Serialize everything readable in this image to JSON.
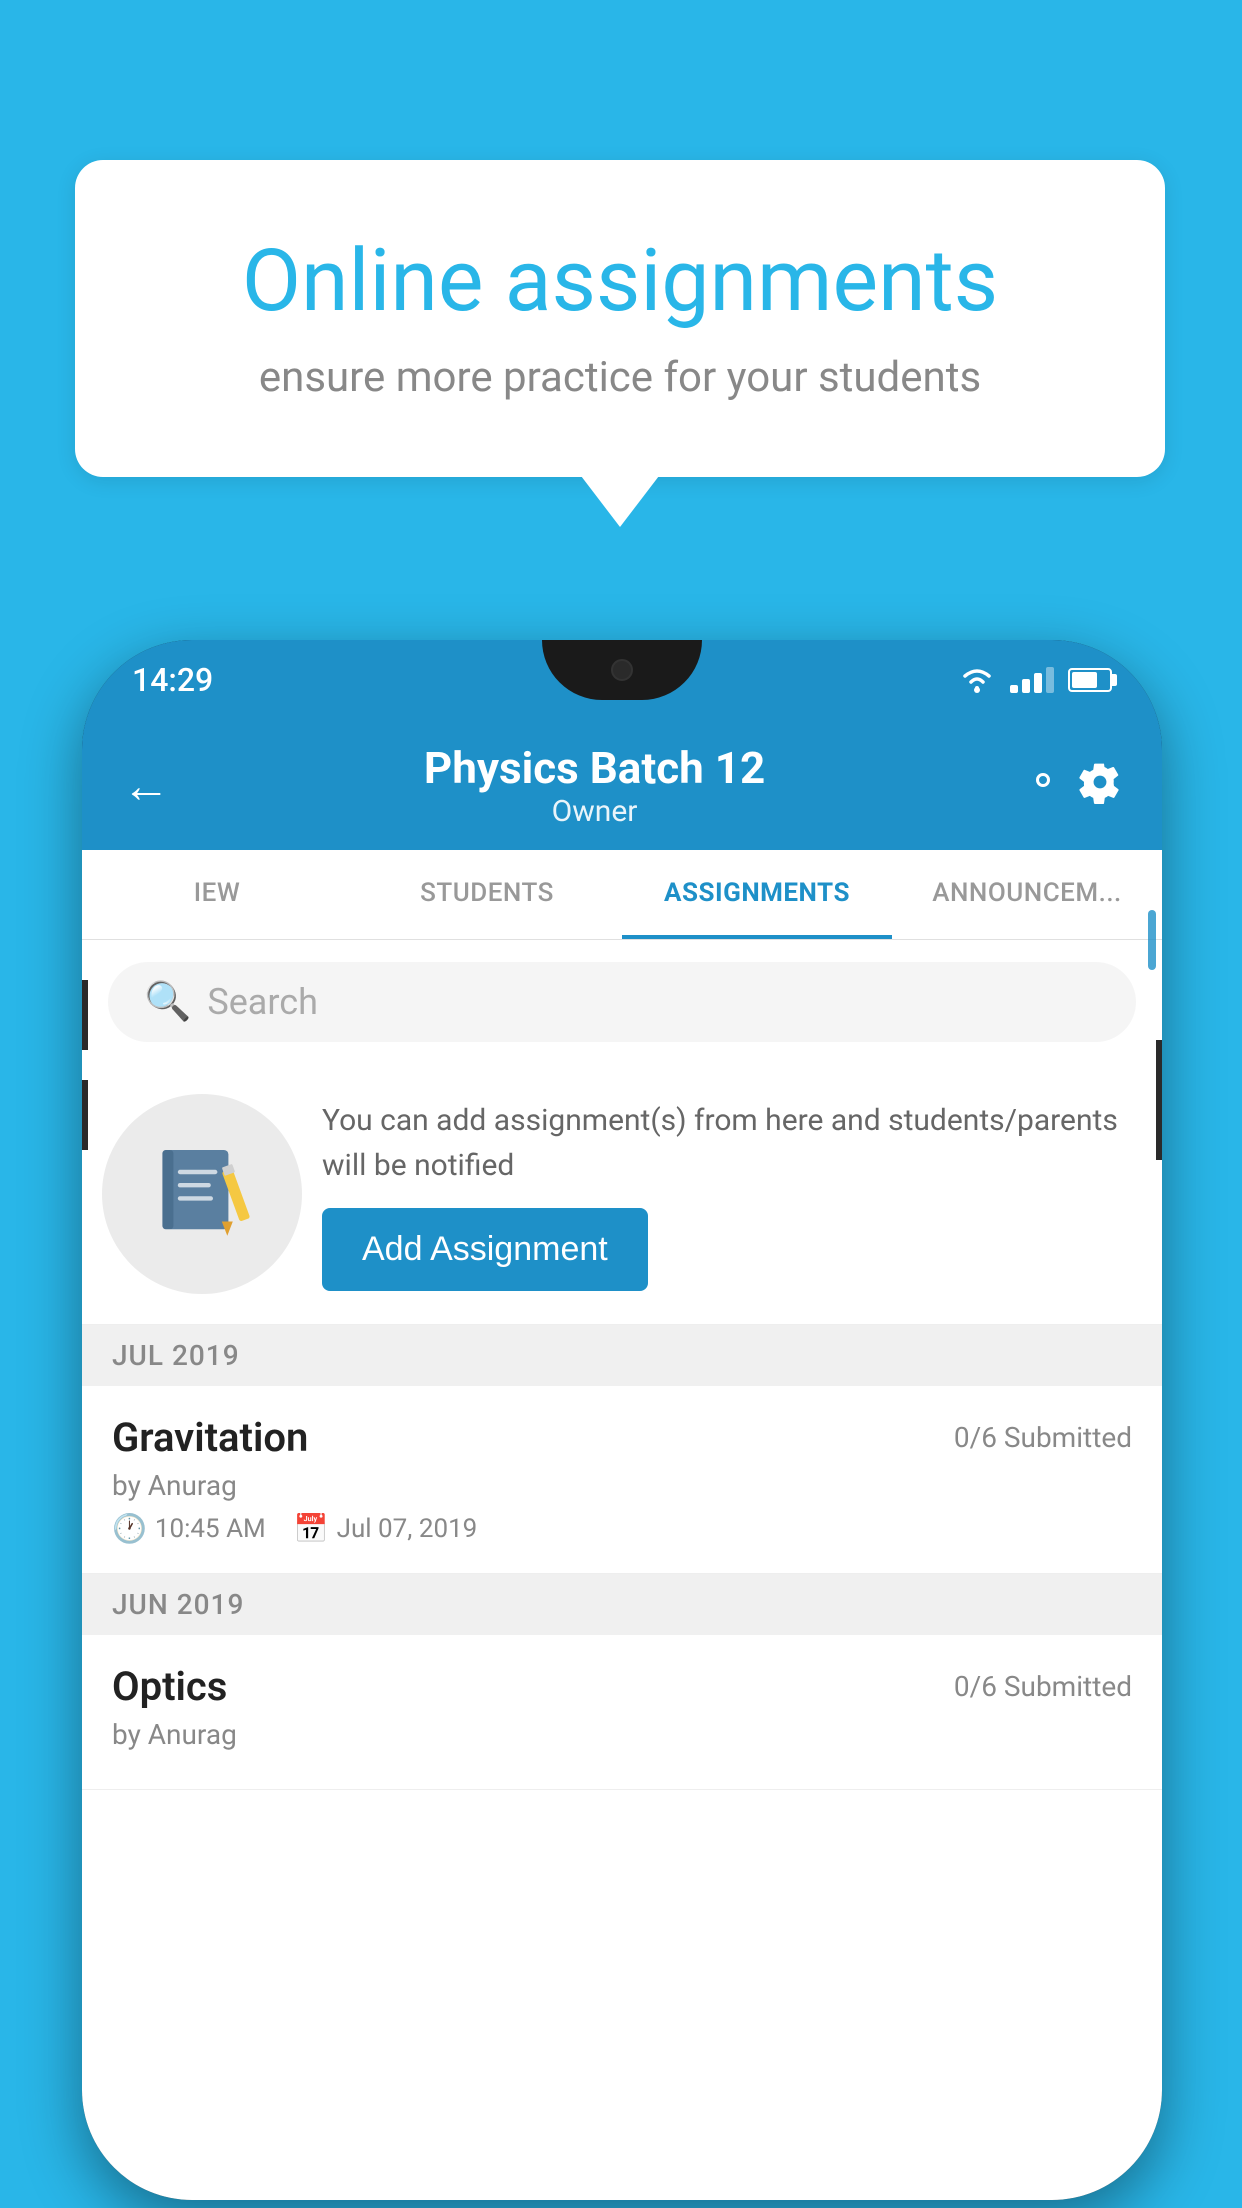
{
  "background": {
    "color": "#29b6e8"
  },
  "speech_bubble": {
    "title": "Online assignments",
    "subtitle": "ensure more practice for your students"
  },
  "phone": {
    "status_bar": {
      "time": "14:29"
    },
    "header": {
      "title": "Physics Batch 12",
      "subtitle": "Owner",
      "back_label": "←"
    },
    "tabs": [
      {
        "label": "IEW",
        "active": false
      },
      {
        "label": "STUDENTS",
        "active": false
      },
      {
        "label": "ASSIGNMENTS",
        "active": true
      },
      {
        "label": "ANNOUNCEM...",
        "active": false
      }
    ],
    "search": {
      "placeholder": "Search"
    },
    "promo": {
      "description": "You can add assignment(s) from here and students/parents will be notified",
      "button_label": "Add Assignment"
    },
    "assignments": [
      {
        "month_label": "JUL 2019",
        "items": [
          {
            "title": "Gravitation",
            "submitted": "0/6 Submitted",
            "author": "by Anurag",
            "time": "10:45 AM",
            "date": "Jul 07, 2019"
          }
        ]
      },
      {
        "month_label": "JUN 2019",
        "items": [
          {
            "title": "Optics",
            "submitted": "0/6 Submitted",
            "author": "by Anurag",
            "time": "",
            "date": ""
          }
        ]
      }
    ]
  }
}
